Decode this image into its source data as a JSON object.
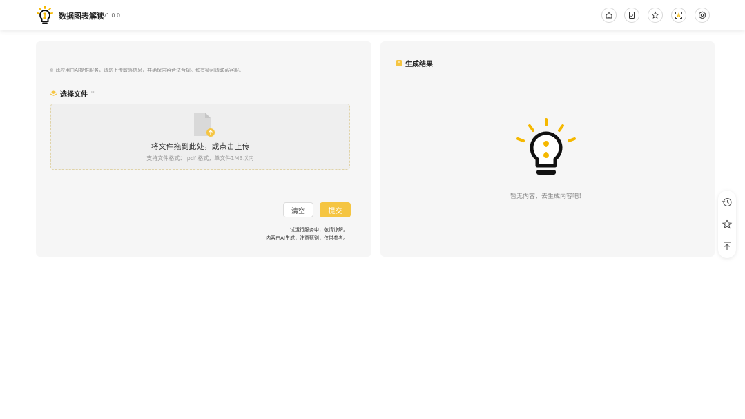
{
  "header": {
    "app_title": "数据图表解读",
    "version": "v1.0.0",
    "buttons": [
      {
        "name": "home-icon",
        "icon": "home"
      },
      {
        "name": "document-icon",
        "icon": "document"
      },
      {
        "name": "star-icon",
        "icon": "star"
      },
      {
        "name": "translate-icon",
        "icon": "translate"
      },
      {
        "name": "gear-icon",
        "icon": "gear"
      }
    ]
  },
  "left_panel": {
    "disclaimer": "※ 此应用由AI提供服务，请勿上传敏感信息，并确保内容合法合规。如有疑问请联系客服。",
    "section_title": "选择文件",
    "required_mark": "*",
    "upload": {
      "main_text": "将文件拖到此处，或点击上传",
      "sub_text": "支持文件格式：.pdf 格式，单文件1MB以内"
    },
    "clear_label": "清空",
    "submit_label": "提交",
    "note_line1": "试运行服务中，敬请谅解。",
    "note_line2": "内容由AI生成，注意甄别，仅供参考。"
  },
  "right_panel": {
    "title": "生成结果",
    "empty_text": "暂无内容，去生成内容吧！"
  },
  "float_bar": {
    "buttons": [
      "history-icon",
      "star-icon",
      "back-to-top-icon"
    ]
  },
  "colors": {
    "accent": "#f5c542",
    "panel_bg": "#f6f6f6"
  }
}
